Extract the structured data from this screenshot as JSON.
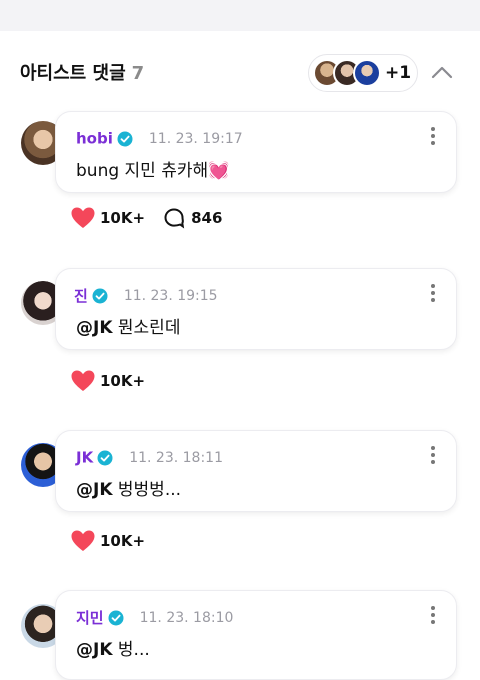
{
  "header": {
    "title": "아티스트 댓글",
    "count": "7",
    "more_avatars": "+1"
  },
  "colors": {
    "name": "#7b2fd6",
    "verified": "#1ab3d3",
    "heart": "#f4475a",
    "time": "#9b9ba3"
  },
  "comments": [
    {
      "name": "hobi",
      "time": "11. 23. 19:17",
      "mention": "",
      "text": "bung 지민 츄카해💓",
      "likes": "10K+",
      "replies": "846"
    },
    {
      "name": "진",
      "time": "11. 23. 19:15",
      "mention": "@JK",
      "text": " 뭔소린데",
      "likes": "10K+",
      "replies": ""
    },
    {
      "name": "JK",
      "time": "11. 23. 18:11",
      "mention": "@JK",
      "text": " 벙벙벙...",
      "likes": "10K+",
      "replies": ""
    },
    {
      "name": "지민",
      "time": "11. 23. 18:10",
      "mention": "@JK",
      "text": " 벙...",
      "likes": "",
      "replies": ""
    }
  ]
}
